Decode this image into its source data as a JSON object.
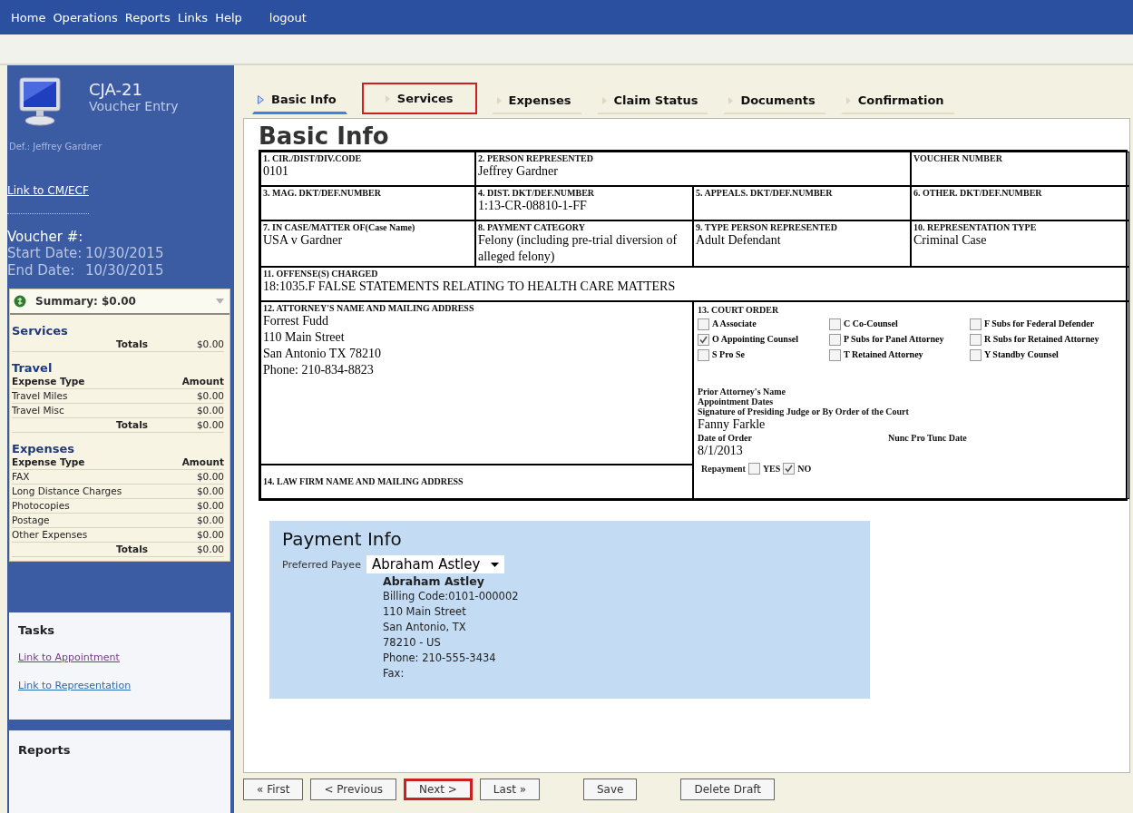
{
  "menu": {
    "items": [
      "Home",
      "Operations",
      "Reports",
      "Links",
      "Help",
      "logout"
    ]
  },
  "sidebar": {
    "title": "CJA-21",
    "subtitle": "Voucher Entry",
    "defendant": "Def.: Jeffrey Gardner",
    "link": "Link to CM/ECF",
    "voucher_label": "Voucher #:",
    "dates": [
      {
        "label": "Start Date:",
        "value": "10/30/2015"
      },
      {
        "label": "End Date:",
        "value": "10/30/2015"
      }
    ],
    "summary": {
      "title": "Summary: $0.00",
      "sections": [
        {
          "title": "Services",
          "totals_label": "Totals",
          "total": "$0.00"
        },
        {
          "title": "Travel",
          "header": [
            "Expense Type",
            "Amount"
          ],
          "rows": [
            {
              "type": "Travel Miles",
              "amount": "$0.00"
            },
            {
              "type": "Travel Misc",
              "amount": "$0.00"
            }
          ],
          "totals_label": "Totals",
          "total": "$0.00"
        },
        {
          "title": "Expenses",
          "header": [
            "Expense Type",
            "Amount"
          ],
          "rows": [
            {
              "type": "FAX",
              "amount": "$0.00"
            },
            {
              "type": "Long Distance Charges",
              "amount": "$0.00"
            },
            {
              "type": "Photocopies",
              "amount": "$0.00"
            },
            {
              "type": "Postage",
              "amount": "$0.00"
            },
            {
              "type": "Other Expenses",
              "amount": "$0.00"
            }
          ],
          "totals_label": "Totals",
          "total": "$0.00"
        }
      ]
    },
    "tasks": {
      "title": "Tasks",
      "links": [
        {
          "label": "Link to Appointment",
          "visited": true
        },
        {
          "label": "Link to Representation",
          "visited": false
        }
      ]
    },
    "reports": {
      "title": "Reports"
    }
  },
  "tabs": [
    {
      "label": "Basic Info",
      "selected": true,
      "highlighted": false
    },
    {
      "label": "Services",
      "selected": false,
      "highlighted": true
    },
    {
      "label": "Expenses",
      "selected": false,
      "highlighted": false
    },
    {
      "label": "Claim Status",
      "selected": false,
      "highlighted": false
    },
    {
      "label": "Documents",
      "selected": false,
      "highlighted": false
    },
    {
      "label": "Confirmation",
      "selected": false,
      "highlighted": false
    }
  ],
  "heading": "Basic Info",
  "form_rows": [
    [
      {
        "kind": "single",
        "label": "1. CIR./DIST/DIV.CODE",
        "value": "0101"
      },
      {
        "kind": "double",
        "label": "2. PERSON REPRESENTED",
        "value": "Jeffrey Gardner"
      },
      {
        "kind": "single",
        "label": "VOUCHER NUMBER"
      }
    ],
    [
      {
        "kind": "single",
        "label": "3. MAG. DKT/DEF.NUMBER"
      },
      {
        "kind": "single",
        "label": "4. DIST. DKT/DEF.NUMBER",
        "value": "1:13-CR-08810-1-FF"
      },
      {
        "kind": "single",
        "label": "5. APPEALS. DKT/DEF.NUMBER"
      },
      {
        "kind": "single",
        "label": "6. OTHER. DKT/DEF.NUMBER"
      }
    ],
    [
      {
        "kind": "single",
        "label": "7. IN CASE/MATTER OF(Case Name)",
        "value": "USA v Gardner"
      },
      {
        "kind": "single",
        "label": "8. PAYMENT CATEGORY",
        "value": "Felony (including pre-trial diversion of alleged felony)"
      },
      {
        "kind": "single",
        "label": "9. TYPE PERSON REPRESENTED",
        "value": "Adult Defendant"
      },
      {
        "kind": "single",
        "label": "10. REPRESENTATION TYPE",
        "value": "Criminal Case"
      }
    ],
    [
      {
        "kind": "full",
        "label": "11. OFFENSE(S) CHARGED",
        "value": "18:1035.F FALSE STATEMENTS RELATING TO HEALTH CARE MATTERS"
      }
    ]
  ],
  "attorney": {
    "label": "12. ATTORNEY'S NAME AND MAILING ADDRESS",
    "lines": [
      "Forrest Fudd",
      "110 Main Street",
      "San Antonio TX 78210",
      "Phone: 210-834-8823"
    ]
  },
  "law_firm": {
    "label": "14. LAW FIRM NAME AND MAILING ADDRESS"
  },
  "court_order": {
    "label": "13. COURT ORDER",
    "options": [
      {
        "label": "A Associate",
        "checked": false
      },
      {
        "label": "C Co-Counsel",
        "checked": false
      },
      {
        "label": "F Subs for Federal Defender",
        "checked": false
      },
      {
        "label": "O Appointing Counsel",
        "checked": true
      },
      {
        "label": "P Subs for Panel Attorney",
        "checked": false
      },
      {
        "label": "R Subs for Retained Attorney",
        "checked": false
      },
      {
        "label": "S Pro Se",
        "checked": false
      },
      {
        "label": "T Retained Attorney",
        "checked": false
      },
      {
        "label": "Y Standby Counsel",
        "checked": false
      }
    ],
    "notes": [
      "Prior Attorney's Name",
      "Appointment Dates",
      "Signature of Presiding Judge or By Order of the Court"
    ],
    "signature": "Fanny Farkle",
    "date_label": "Date of Order",
    "nunc_label": "Nunc Pro Tunc Date",
    "date": "8/1/2013",
    "repayment": {
      "label": "Repayment",
      "options": [
        {
          "label": "YES",
          "checked": false
        },
        {
          "label": "NO",
          "checked": true
        }
      ]
    }
  },
  "payment": {
    "title": "Payment Info",
    "payee_label": "Preferred Payee",
    "payee": "Abraham Astley",
    "name": "Abraham Astley",
    "lines": [
      "Billing Code:0101-000002",
      "110 Main Street",
      "San Antonio, TX",
      "78210 - US",
      "Phone: 210-555-3434",
      "Fax:"
    ]
  },
  "buttons": [
    {
      "label": "« First",
      "highlighted": false
    },
    {
      "label": "< Previous",
      "highlighted": false
    },
    {
      "label": "Next >",
      "highlighted": true
    },
    {
      "label": "Last »",
      "highlighted": false
    },
    {
      "label": "Save",
      "highlighted": false
    },
    {
      "label": "Delete Draft",
      "highlighted": false
    }
  ]
}
